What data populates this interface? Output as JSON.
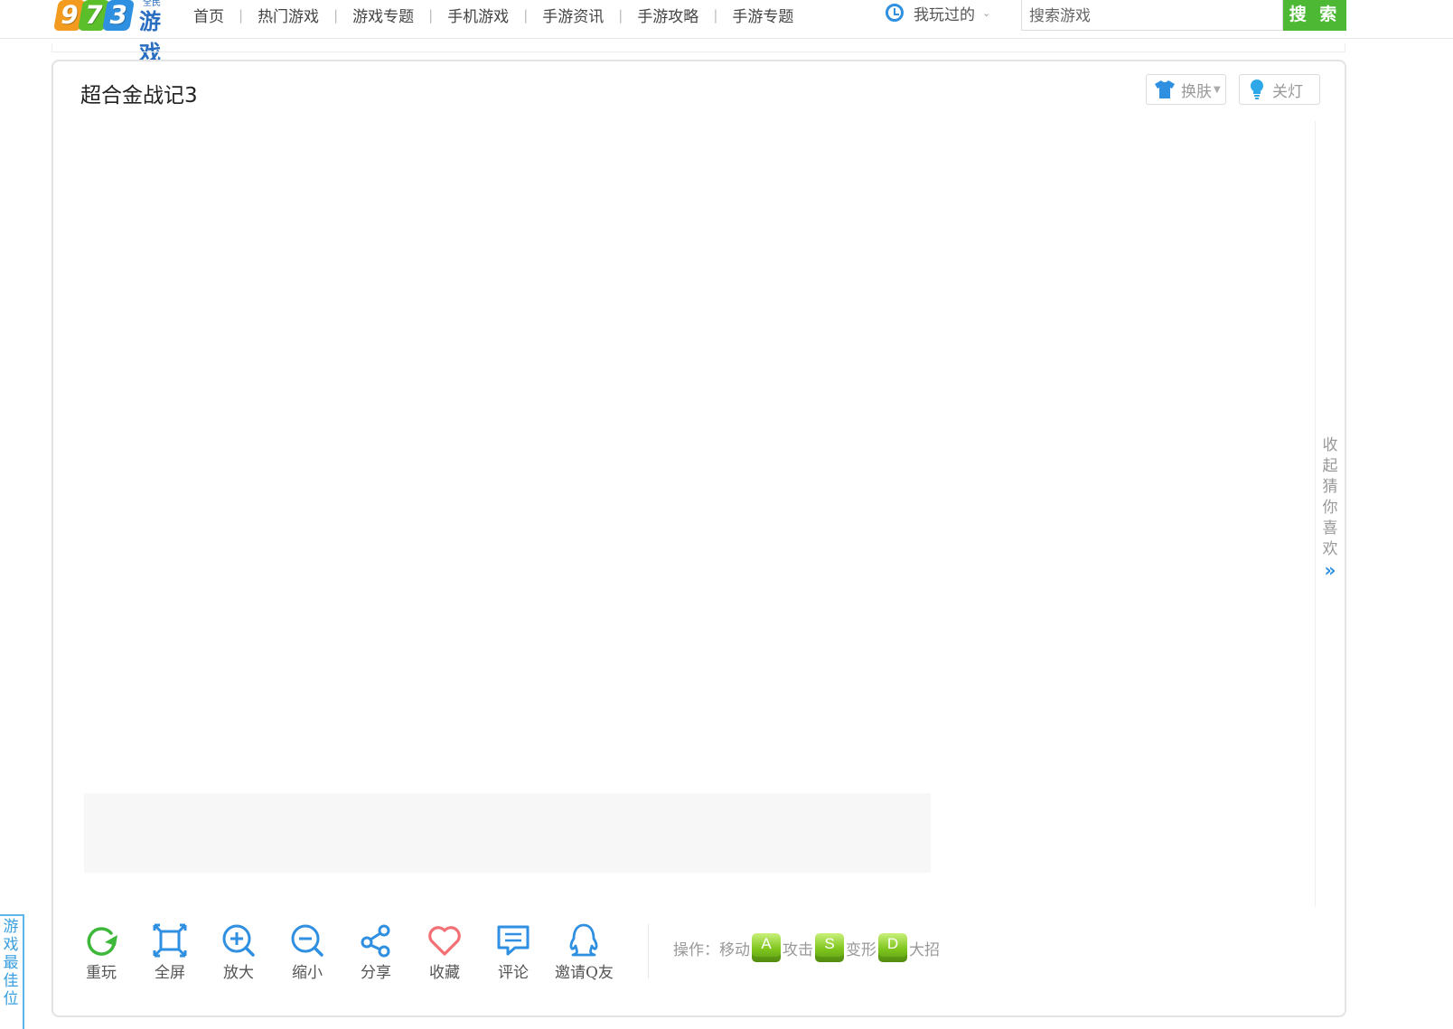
{
  "logo": {
    "digits": [
      "9",
      "7",
      "3"
    ],
    "word": "游戏",
    "tiny": "全民"
  },
  "nav": [
    "首页",
    "热门游戏",
    "游戏专题",
    "手机游戏",
    "手游资讯",
    "手游攻略",
    "手游专题"
  ],
  "played": {
    "label": "我玩过的"
  },
  "search": {
    "placeholder": "搜索游戏",
    "button": "搜 索"
  },
  "game": {
    "title": "超合金战记3"
  },
  "tools": {
    "skin": "换肤",
    "light": "关灯"
  },
  "collapse": {
    "text": "收起猜你喜欢",
    "arrow": "»"
  },
  "toolbar": {
    "items": [
      {
        "label": "重玩",
        "icon": "replay-icon"
      },
      {
        "label": "全屏",
        "icon": "fullscreen-icon"
      },
      {
        "label": "放大",
        "icon": "zoom-in-icon"
      },
      {
        "label": "缩小",
        "icon": "zoom-out-icon"
      },
      {
        "label": "分享",
        "icon": "share-icon"
      },
      {
        "label": "收藏",
        "icon": "heart-icon"
      },
      {
        "label": "评论",
        "icon": "comment-icon"
      },
      {
        "label": "邀请Q友",
        "icon": "qq-icon"
      }
    ]
  },
  "controls": {
    "prefix": "操作：",
    "move": "移动",
    "key_a": "A",
    "attack": "攻击",
    "key_s": "S",
    "transform": "变形",
    "key_d": "D",
    "ultimate": "大招"
  },
  "side_tab": {
    "text": "游戏最佳位"
  },
  "colors": {
    "brand_green": "#4cb833",
    "brand_blue": "#2f8fe0",
    "heart_red": "#f26f73",
    "tool_green": "#3db83a"
  }
}
